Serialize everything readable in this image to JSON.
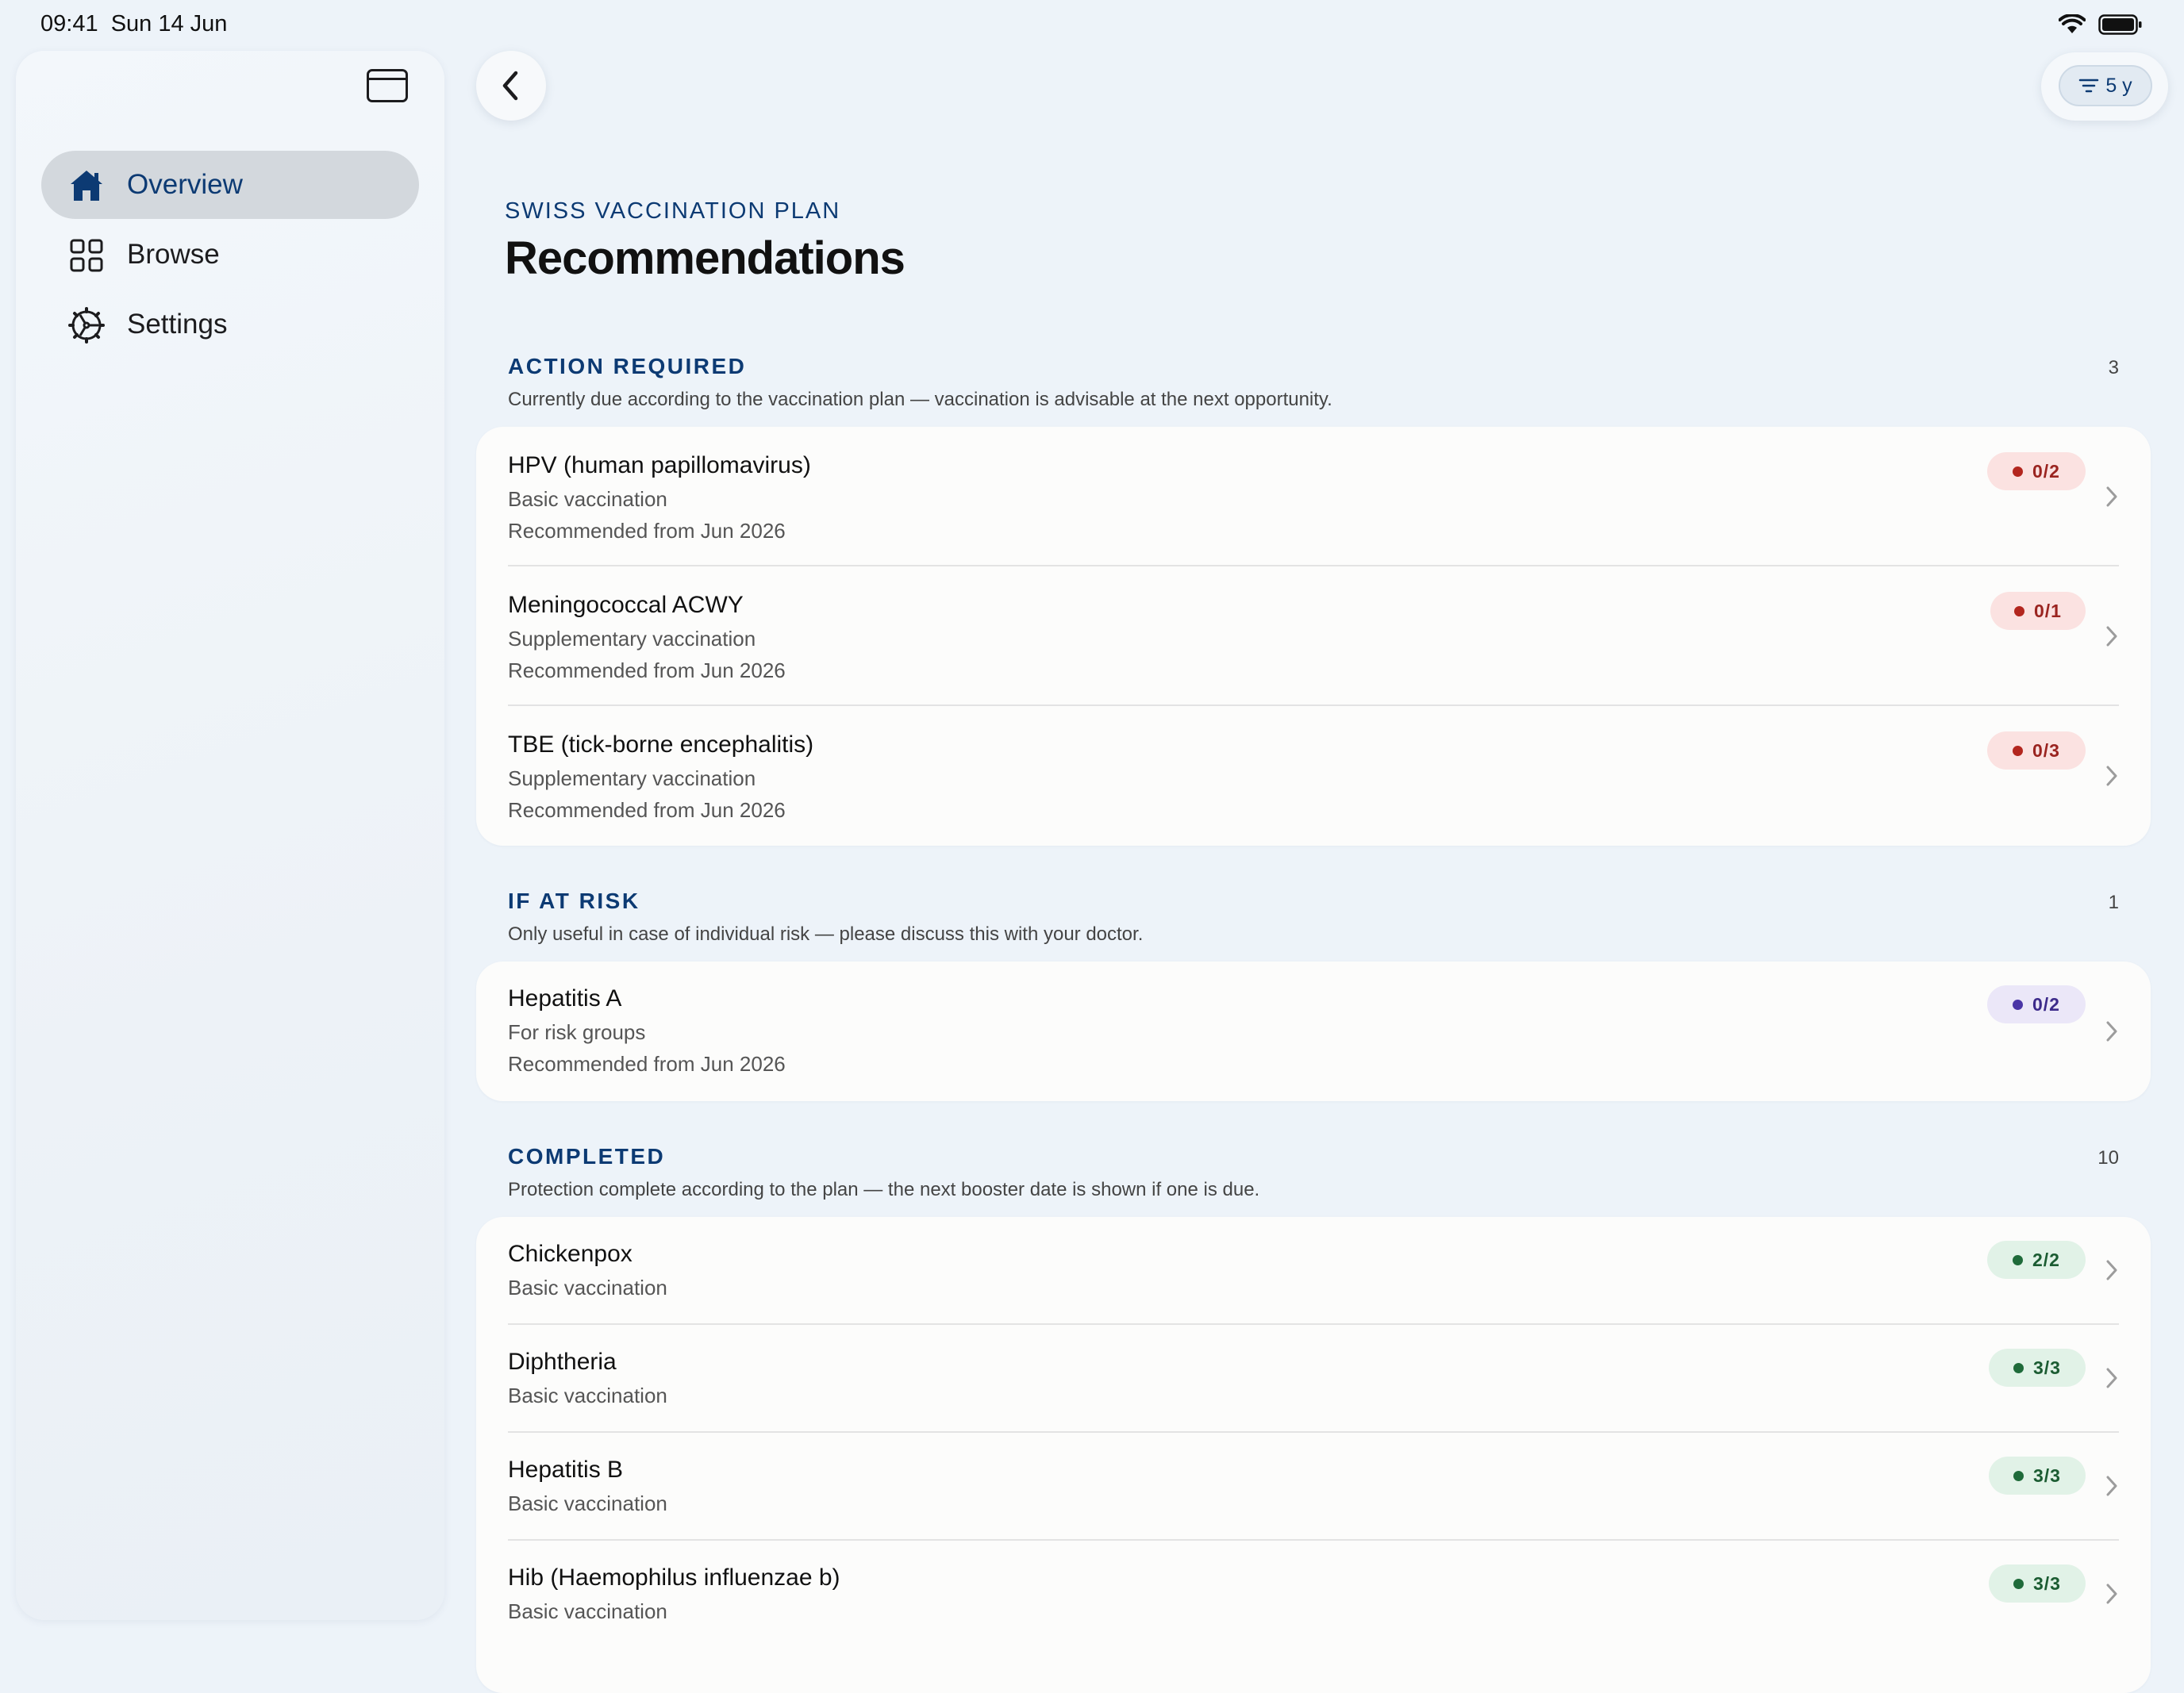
{
  "status_bar": {
    "time": "09:41",
    "date": "Sun 14 Jun",
    "wifi_icon": "wifi-icon",
    "battery_icon": "battery-icon"
  },
  "sidebar": {
    "toggle_icon": "sidebar-toggle-icon",
    "items": [
      {
        "label": "Overview",
        "icon": "house-icon",
        "active": true
      },
      {
        "label": "Browse",
        "icon": "grid-icon",
        "active": false
      },
      {
        "label": "Settings",
        "icon": "gear-icon",
        "active": false
      }
    ]
  },
  "toolbar": {
    "back_icon": "chevron-left-icon",
    "filter_icon": "filter-lines-icon",
    "filter_label": "5 y"
  },
  "header": {
    "eyebrow": "SWISS VACCINATION PLAN",
    "title": "Recommendations"
  },
  "sections": [
    {
      "title": "ACTION REQUIRED",
      "count": "3",
      "description": "Currently due according to the vaccination plan — vaccination is advisable at the next opportunity.",
      "items": [
        {
          "title": "HPV (human papillomavirus)",
          "type": "Basic vaccination",
          "recommended": "Recommended from Jun 2026",
          "badge": "0/2",
          "status": "red"
        },
        {
          "title": "Meningococcal ACWY",
          "type": "Supplementary vaccination",
          "recommended": "Recommended from Jun 2026",
          "badge": "0/1",
          "status": "red"
        },
        {
          "title": "TBE (tick-borne encephalitis)",
          "type": "Supplementary vaccination",
          "recommended": "Recommended from Jun 2026",
          "badge": "0/3",
          "status": "red"
        }
      ]
    },
    {
      "title": "IF AT RISK",
      "count": "1",
      "description": "Only useful in case of individual risk — please discuss this with your doctor.",
      "items": [
        {
          "title": "Hepatitis A",
          "type": "For risk groups",
          "recommended": "Recommended from Jun 2026",
          "badge": "0/2",
          "status": "purple"
        }
      ]
    },
    {
      "title": "COMPLETED",
      "count": "10",
      "description": "Protection complete according to the plan — the next booster date is shown if one is due.",
      "items": [
        {
          "title": "Chickenpox",
          "type": "Basic vaccination",
          "badge": "2/2",
          "status": "green"
        },
        {
          "title": "Diphtheria",
          "type": "Basic vaccination",
          "badge": "3/3",
          "status": "green"
        },
        {
          "title": "Hepatitis B",
          "type": "Basic vaccination",
          "badge": "3/3",
          "status": "green"
        },
        {
          "title": "Hib (Haemophilus influenzae b)",
          "type": "Basic vaccination",
          "badge": "3/3",
          "status": "green"
        }
      ]
    }
  ]
}
